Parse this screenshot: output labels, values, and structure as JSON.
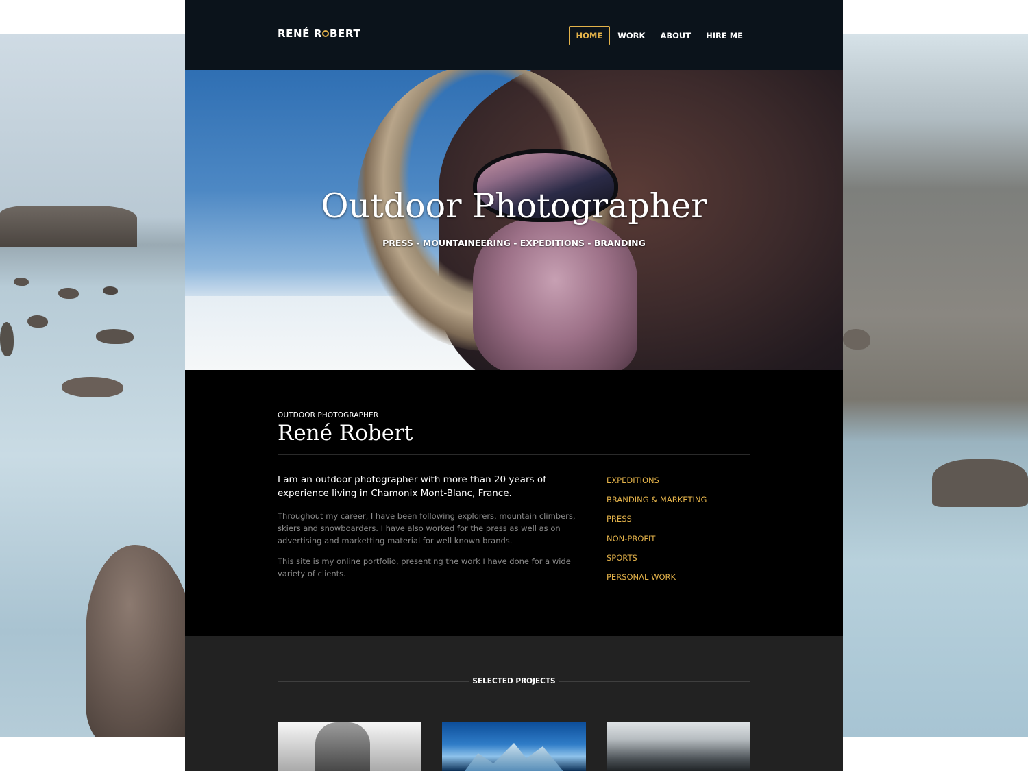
{
  "brand": {
    "name_part1": "RENÉ R",
    "name_part2": "BERT"
  },
  "nav": {
    "items": [
      {
        "label": "HOME",
        "active": true
      },
      {
        "label": "WORK",
        "active": false
      },
      {
        "label": "ABOUT",
        "active": false
      },
      {
        "label": "HIRE ME",
        "active": false
      }
    ]
  },
  "hero": {
    "title": "Outdoor Photographer",
    "subtitle": "PRESS - MOUNTAINEERING - EXPEDITIONS - BRANDING"
  },
  "about": {
    "eyebrow": "OUTDOOR PHOTOGRAPHER",
    "name": "René Robert",
    "lead": "I am an outdoor photographer with more than 20 years of experience living in Chamonix Mont-Blanc, France.",
    "paragraphs": [
      "Throughout my career, I have been following explorers, mountain climbers, skiers and snowboarders. I have also worked for the press as well as on advertising and marketting material for well known brands.",
      "This site is my online portfolio, presenting the work I have done for a wide variety of clients."
    ],
    "categories": [
      "EXPEDITIONS",
      "BRANDING & MARKETING",
      "PRESS",
      "NON-PROFIT",
      "SPORTS",
      "PERSONAL WORK"
    ]
  },
  "projects": {
    "heading": "SELECTED PROJECTS"
  },
  "colors": {
    "accent": "#e3b24a",
    "header_bg": "#0b131b",
    "about_bg": "#000000",
    "projects_bg": "#222222"
  }
}
